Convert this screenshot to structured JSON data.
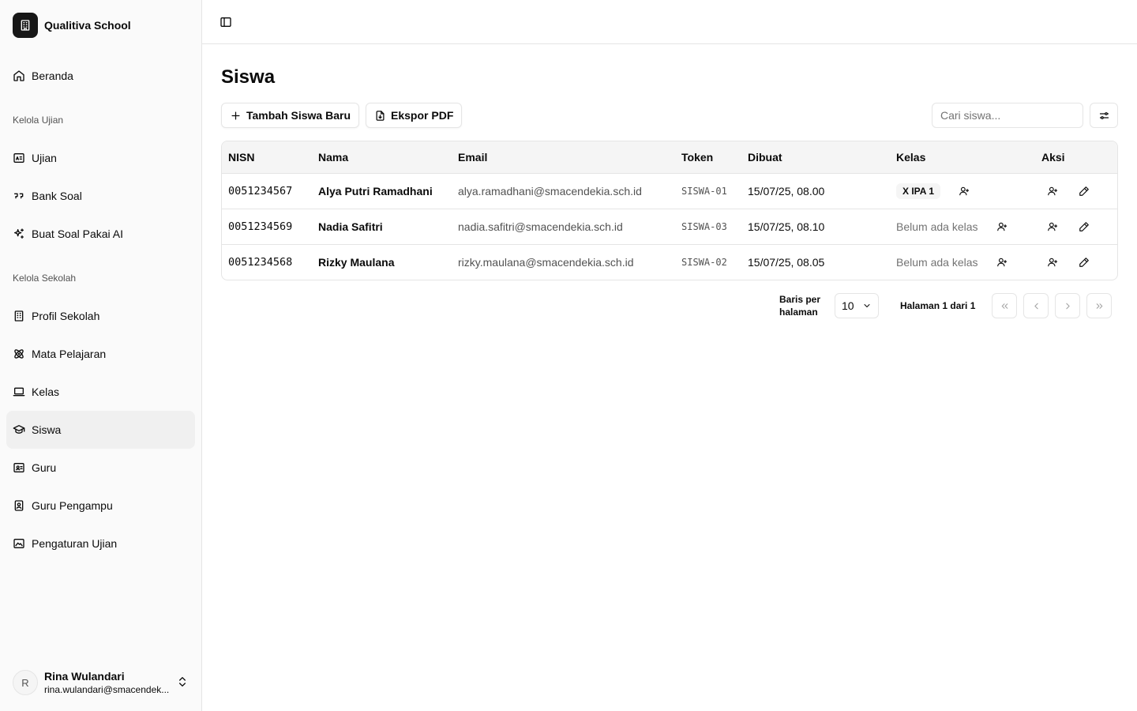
{
  "app": {
    "name": "Qualitiva School",
    "logo_icon": "school-building-icon"
  },
  "sidebar": {
    "home": {
      "label": "Beranda",
      "icon": "home-icon"
    },
    "sections": [
      {
        "label": "Kelola Ujian",
        "items": [
          {
            "label": "Ujian",
            "icon": "exam-icon"
          },
          {
            "label": "Bank Soal",
            "icon": "quote-icon"
          },
          {
            "label": "Buat Soal Pakai AI",
            "icon": "sparkles-icon"
          }
        ]
      },
      {
        "label": "Kelola Sekolah",
        "items": [
          {
            "label": "Profil Sekolah",
            "icon": "building-icon"
          },
          {
            "label": "Mata Pelajaran",
            "icon": "atom-icon"
          },
          {
            "label": "Kelas",
            "icon": "laptop-icon"
          },
          {
            "label": "Siswa",
            "icon": "graduation-cap-icon",
            "active": true
          },
          {
            "label": "Guru",
            "icon": "id-card-icon"
          },
          {
            "label": "Guru Pengampu",
            "icon": "badge-icon"
          },
          {
            "label": "Pengaturan Ujian",
            "icon": "settings-image-icon"
          }
        ]
      }
    ],
    "user": {
      "initial": "R",
      "name": "Rina Wulandari",
      "email": "rina.wulandari@smacendek..."
    }
  },
  "page": {
    "title": "Siswa",
    "actions": {
      "add_label": "Tambah Siswa Baru",
      "export_label": "Ekspor PDF"
    },
    "search": {
      "placeholder": "Cari siswa..."
    }
  },
  "table": {
    "columns": [
      "NISN",
      "Nama",
      "Email",
      "Token",
      "Dibuat",
      "Kelas",
      "Aksi"
    ],
    "rows": [
      {
        "nisn": "0051234567",
        "nama": "Alya Putri Ramadhani",
        "email": "alya.ramadhani@smacendekia.sch.id",
        "token": "SISWA-01",
        "dibuat": "15/07/25, 08.00",
        "kelas": "X IPA 1",
        "has_class": true
      },
      {
        "nisn": "0051234569",
        "nama": "Nadia Safitri",
        "email": "nadia.safitri@smacendekia.sch.id",
        "token": "SISWA-03",
        "dibuat": "15/07/25, 08.10",
        "kelas": "Belum ada kelas",
        "has_class": false
      },
      {
        "nisn": "0051234568",
        "nama": "Rizky Maulana",
        "email": "rizky.maulana@smacendekia.sch.id",
        "token": "SISWA-02",
        "dibuat": "15/07/25, 08.05",
        "kelas": "Belum ada kelas",
        "has_class": false
      }
    ]
  },
  "pagination": {
    "rows_label": "Baris per halaman",
    "rows_value": "10",
    "page_info": "Halaman 1 dari 1"
  }
}
